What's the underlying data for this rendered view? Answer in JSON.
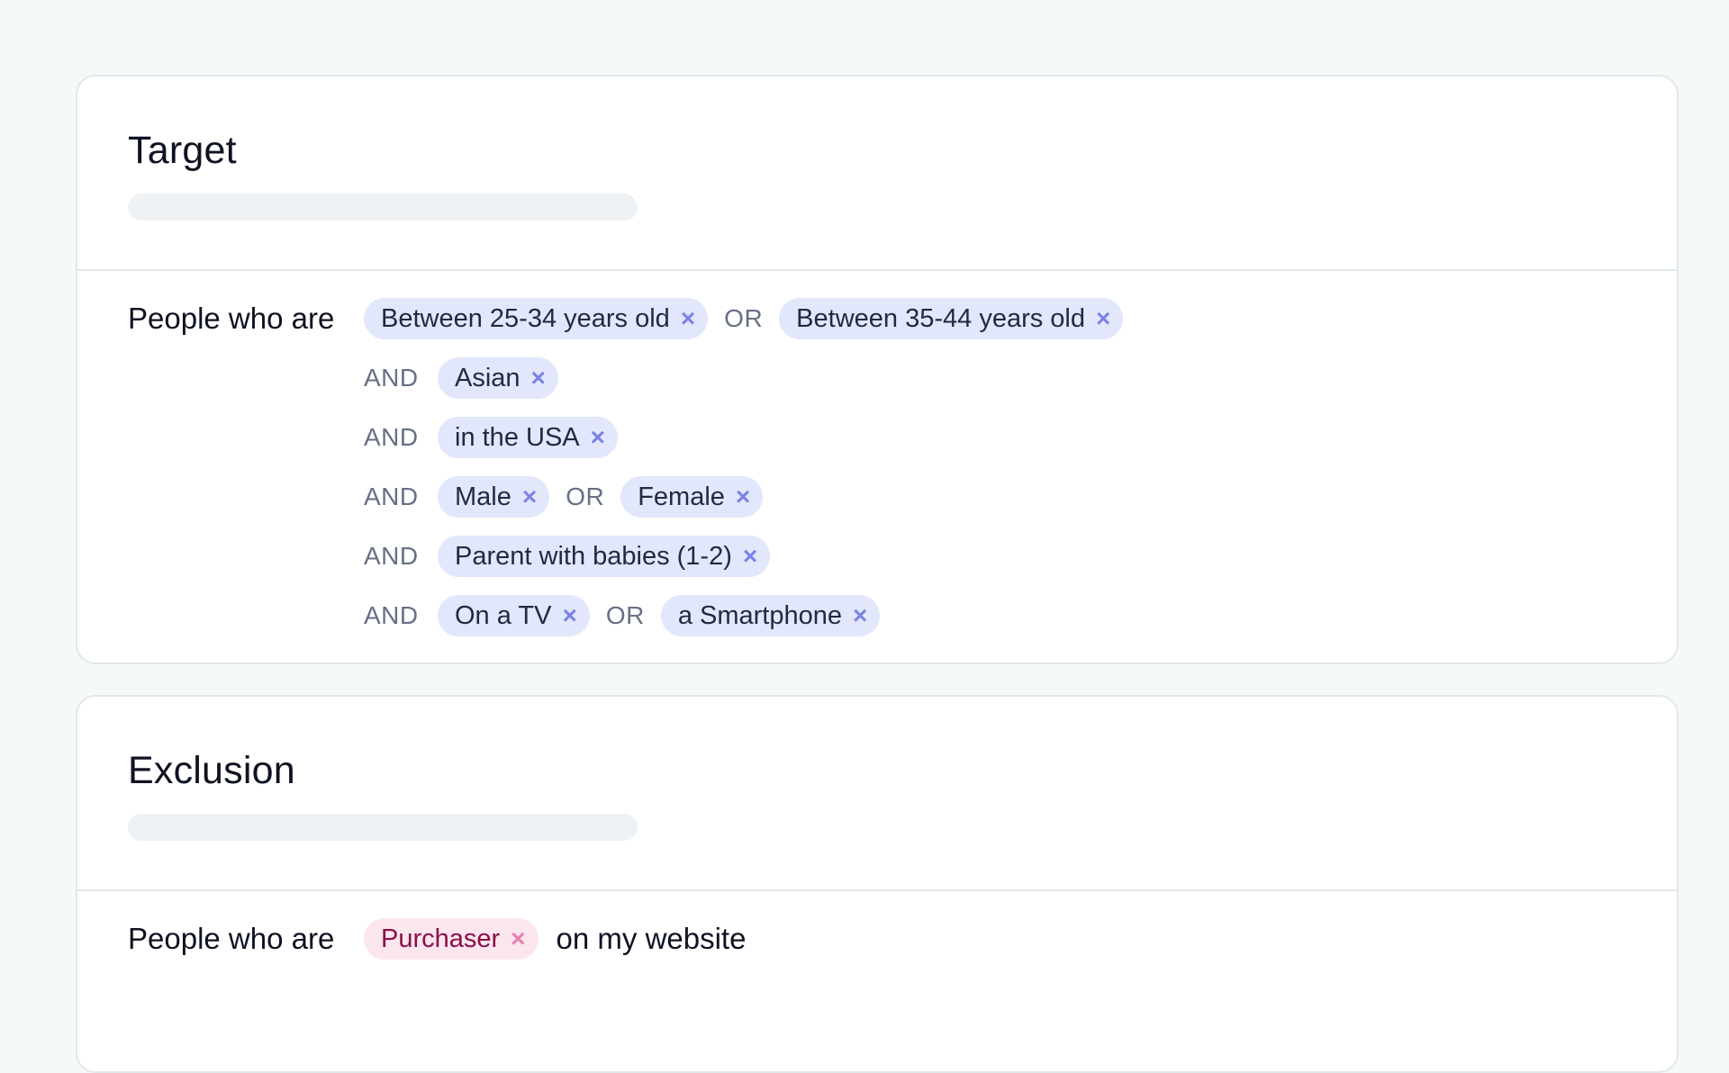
{
  "target": {
    "title": "Target",
    "lead": "People who are",
    "rows": [
      {
        "conj": "",
        "chips": [
          "Between 25-34 years old",
          "Between 35-44 years old"
        ]
      },
      {
        "conj": "AND",
        "chips": [
          "Asian"
        ]
      },
      {
        "conj": "AND",
        "chips": [
          "in the USA"
        ]
      },
      {
        "conj": "AND",
        "chips": [
          "Male",
          "Female"
        ]
      },
      {
        "conj": "AND",
        "chips": [
          "Parent with babies (1-2)"
        ]
      },
      {
        "conj": "AND",
        "chips": [
          "On a TV",
          "a Smartphone"
        ]
      }
    ],
    "or_label": "OR"
  },
  "exclusion": {
    "title": "Exclusion",
    "lead": "People who are",
    "chips": [
      "Purchaser"
    ],
    "tail": "on my website"
  },
  "icons": {
    "remove": "×"
  },
  "colors": {
    "chip_bg": "#e2e7fb",
    "chip_x": "#7b83e6",
    "exclusion_chip_bg": "#fbe6ee",
    "exclusion_chip_text": "#8a0f4a",
    "exclusion_chip_x": "#ea7fb1",
    "page_bg": "#f6f9f9"
  }
}
